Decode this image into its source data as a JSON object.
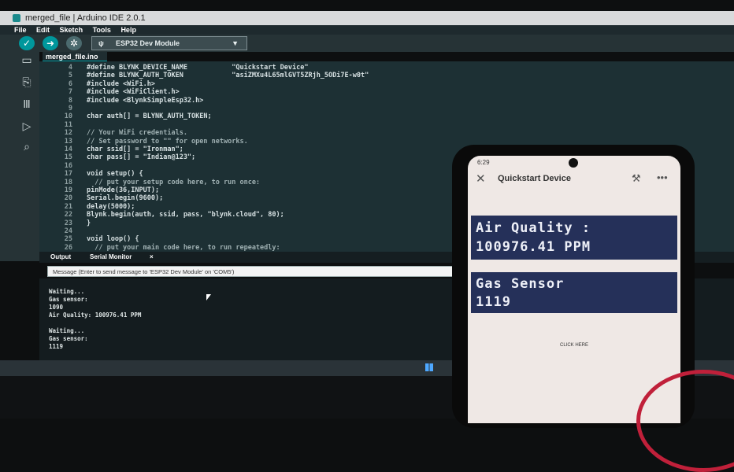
{
  "window": {
    "title": "merged_file | Arduino IDE 2.0.1"
  },
  "menu": [
    "File",
    "Edit",
    "Sketch",
    "Tools",
    "Help"
  ],
  "toolbar": {
    "verify_icon": "check-icon",
    "upload_icon": "arrow-right-icon",
    "debug_icon": "debug-icon",
    "board": "ESP32 Dev Module"
  },
  "file_tab": "merged_file.ino",
  "code_lines": [
    {
      "n": "4",
      "t": "#define BLYNK_DEVICE_NAME           \"Quickstart Device\""
    },
    {
      "n": "5",
      "t": "#define BLYNK_AUTH_TOKEN            \"asiZMXu4L65mlGVT5ZRjh_5ODi7E-w0t\""
    },
    {
      "n": "6",
      "t": "#include <WiFi.h>"
    },
    {
      "n": "7",
      "t": "#include <WiFiClient.h>"
    },
    {
      "n": "8",
      "t": "#include <BlynkSimpleEsp32.h>"
    },
    {
      "n": "9",
      "t": ""
    },
    {
      "n": "10",
      "t": "char auth[] = BLYNK_AUTH_TOKEN;"
    },
    {
      "n": "11",
      "t": ""
    },
    {
      "n": "12",
      "t": "// Your WiFi credentials."
    },
    {
      "n": "13",
      "t": "// Set password to \"\" for open networks."
    },
    {
      "n": "14",
      "t": "char ssid[] = \"Ironman\";"
    },
    {
      "n": "15",
      "t": "char pass[] = \"Indian@123\";"
    },
    {
      "n": "16",
      "t": ""
    },
    {
      "n": "17",
      "t": "void setup() {"
    },
    {
      "n": "18",
      "t": "  // put your setup code here, to run once:"
    },
    {
      "n": "19",
      "t": "pinMode(36,INPUT);"
    },
    {
      "n": "20",
      "t": "Serial.begin(9600);"
    },
    {
      "n": "21",
      "t": "delay(5000);"
    },
    {
      "n": "22",
      "t": "Blynk.begin(auth, ssid, pass, \"blynk.cloud\", 80);"
    },
    {
      "n": "23",
      "t": "}"
    },
    {
      "n": "24",
      "t": ""
    },
    {
      "n": "25",
      "t": "void loop() {"
    },
    {
      "n": "26",
      "t": "  // put your main code here, to run repeatedly:"
    }
  ],
  "panel": {
    "output_tab": "Output",
    "serial_tab": "Serial Monitor",
    "close": "×"
  },
  "serial_input_placeholder": "Message (Enter to send message to 'ESP32 Dev Module' on 'COM5')",
  "serial_lines": [
    "Waiting...",
    "Gas sensor:",
    "1090",
    "Air Quality: 100976.41  PPM",
    "",
    "Waiting...",
    "Gas sensor:",
    "1119"
  ],
  "phone": {
    "time": "6:29",
    "title": "Quickstart Device",
    "air_quality_label": "Air Quality :",
    "air_quality_value": "100976.41 PPM",
    "gas_label": "Gas Sensor",
    "gas_value": "1119",
    "button": "CLICK HERE"
  },
  "colors": {
    "accent": "#00979c",
    "editor_bg": "#1d3034",
    "widget_bg": "#253059",
    "cable": "#c0203a"
  }
}
